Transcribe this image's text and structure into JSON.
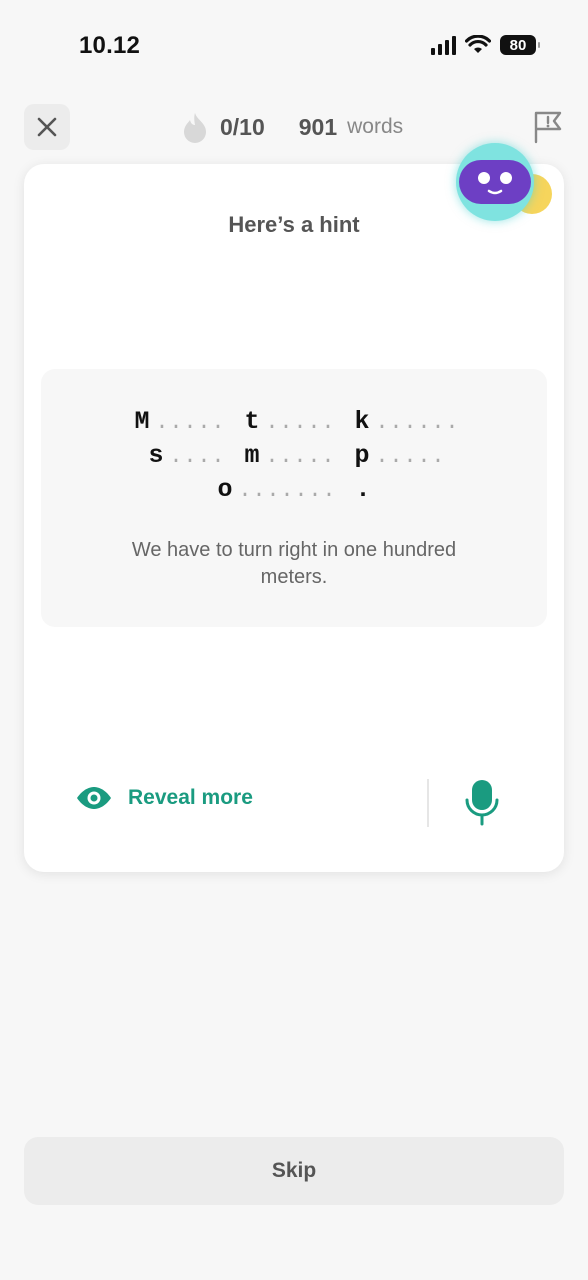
{
  "status_bar": {
    "time": "10.12",
    "battery": "80"
  },
  "header": {
    "progress": "0/10",
    "word_count": "901",
    "word_label": "words"
  },
  "card": {
    "title": "Here’s a hint",
    "hint_lines": [
      [
        {
          "t": "M"
        },
        {
          "d": 5
        },
        {
          "g": 1
        },
        {
          "t": "t"
        },
        {
          "d": 5
        },
        {
          "g": 1
        },
        {
          "t": "k"
        },
        {
          "d": 6
        }
      ],
      [
        {
          "t": "s"
        },
        {
          "d": 4
        },
        {
          "g": 1
        },
        {
          "t": "m"
        },
        {
          "d": 5
        },
        {
          "g": 1
        },
        {
          "t": "p"
        },
        {
          "d": 5
        }
      ],
      [
        {
          "t": "o"
        },
        {
          "d": 7
        },
        {
          "g": 1
        },
        {
          "t": "."
        }
      ]
    ],
    "translation": "We have to turn right in one hundred meters.",
    "reveal_label": "Reveal more"
  },
  "colors": {
    "accent": "#1a9b80",
    "bot": "#6d3fc4"
  },
  "skip_label": "Skip"
}
